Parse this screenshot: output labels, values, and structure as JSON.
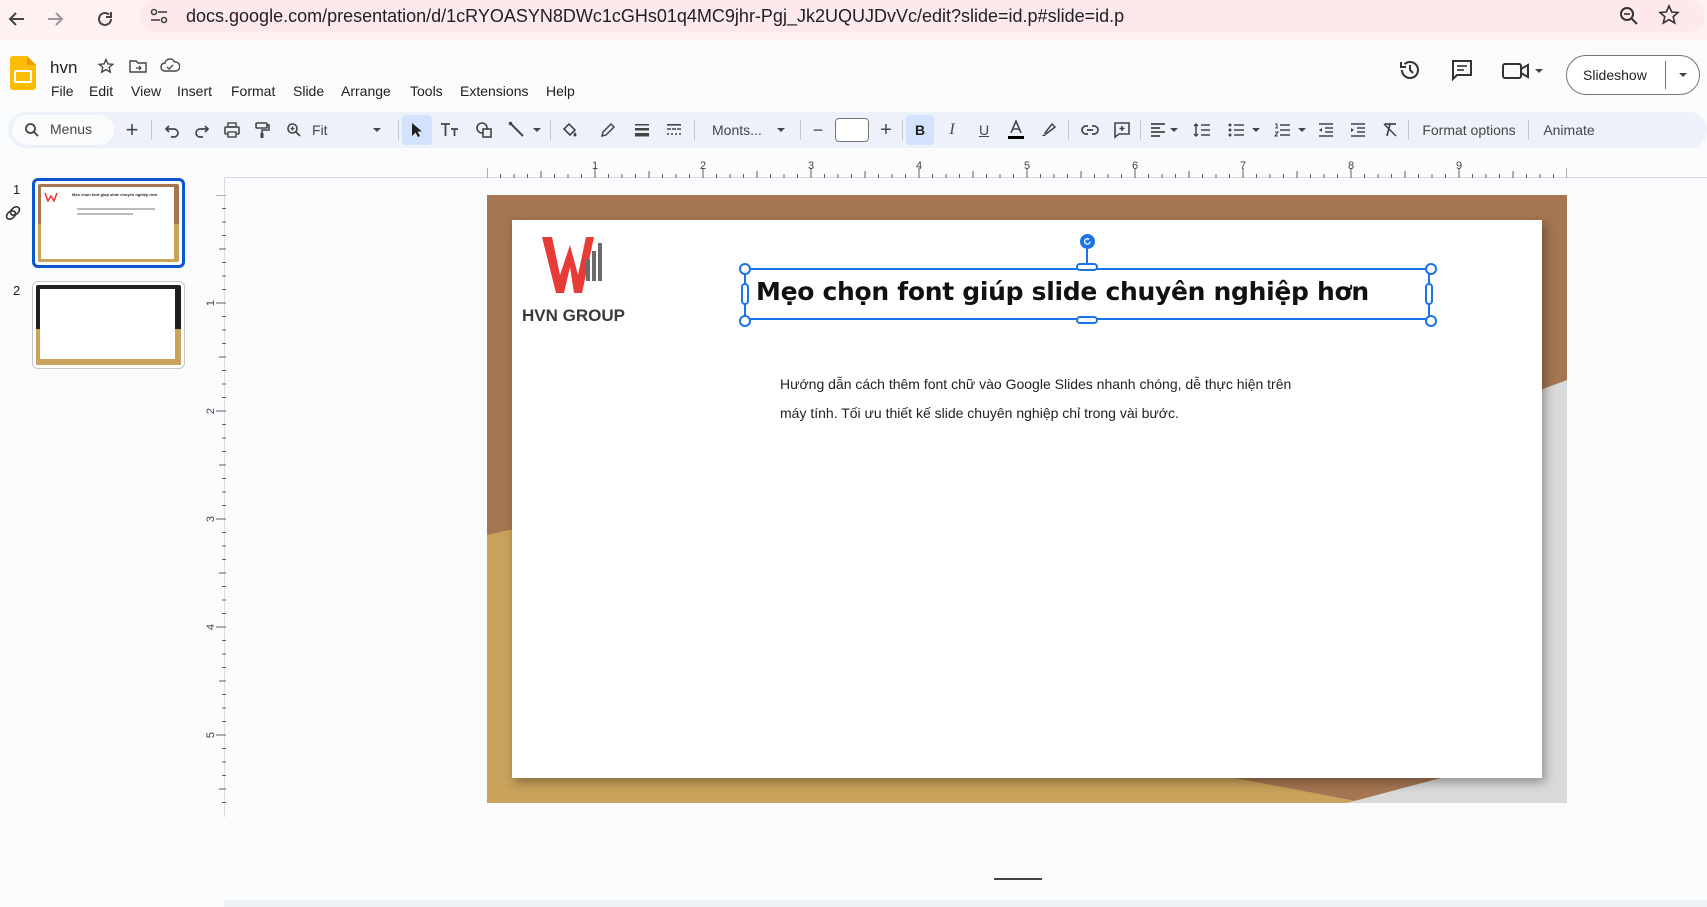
{
  "browser": {
    "url": "docs.google.com/presentation/d/1cRYOASYN8DWc1cGHs01q4MC9jhr-Pgj_Jk2UQUJDvVc/edit?slide=id.p#slide=id.p"
  },
  "app": {
    "doc_title": "hvn",
    "menu": [
      "File",
      "Edit",
      "View",
      "Insert",
      "Format",
      "Slide",
      "Arrange",
      "Tools",
      "Extensions",
      "Help"
    ],
    "slideshow_label": "Slideshow",
    "brand_color": "#fbbc04",
    "accent_color": "#1a73e8"
  },
  "toolbar": {
    "menus_label": "Menus",
    "zoom_label": "Fit",
    "font_label": "Monts...",
    "font_size_value": "",
    "format_options_label": "Format options",
    "animate_label": "Animate"
  },
  "filmstrip": {
    "slides": [
      {
        "number": "1",
        "selected": true
      },
      {
        "number": "2",
        "selected": false
      }
    ],
    "thumb1_title": "Mẹo chọn font giúp slide chuyên nghiệp hơn"
  },
  "ruler": {
    "horizontal": [
      "1",
      "2",
      "3",
      "4",
      "5",
      "6",
      "7",
      "8",
      "9"
    ],
    "vertical": [
      "1",
      "2",
      "3",
      "4",
      "5"
    ]
  },
  "slide": {
    "logo_text": "HVN GROUP",
    "title": "Mẹo chọn font giúp slide chuyên nghiệp hơn",
    "body_line1": "Hướng dẫn cách thêm font chữ vào Google Slides nhanh chóng, dễ thực hiện trên",
    "body_line2": "máy tính. Tối ưu thiết kế slide chuyên nghiệp chỉ trong vài bước.",
    "colors": {
      "frame": "#a57651",
      "gold": "#c9a25c",
      "grey": "#d9d9d9",
      "logo_red": "#e63b36",
      "logo_grey": "#6b6b6b"
    }
  }
}
